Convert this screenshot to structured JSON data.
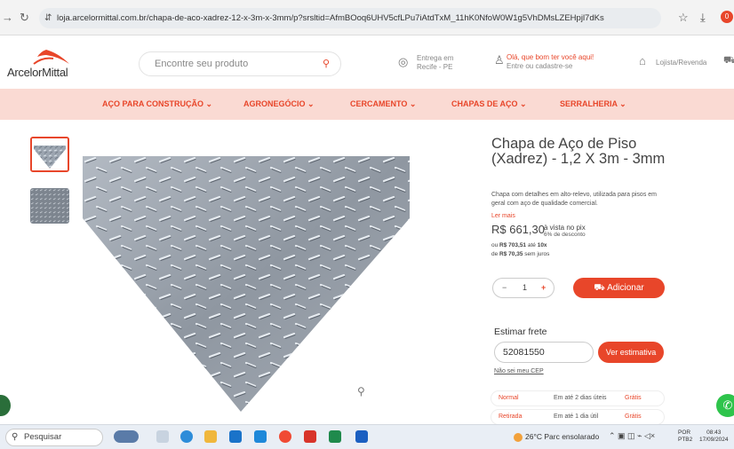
{
  "browser": {
    "url": "loja.arcelormittal.com.br/chapa-de-aco-xadrez-12-x-3m-x-3mm/p?srsltid=AfmBOoq6UHV5cfLPu7iAtdTxM_11hK0NfoW0W1g5VhDMsLZEHpjl7dKs",
    "extension_badge": "0"
  },
  "header": {
    "logo_text": "ArcelorMittal",
    "search_placeholder": "Encontre seu produto",
    "delivery_line1": "Entrega em",
    "delivery_line2": "Recife - PE",
    "greeting_line1": "Olá, que bom ter você aqui!",
    "greeting_line2": "Entre ou cadastre-se",
    "store_label": "Lojista/Revenda"
  },
  "categories": [
    {
      "label": "AÇO PARA CONSTRUÇÃO ⌄"
    },
    {
      "label": "AGRONEGÓCIO ⌄"
    },
    {
      "label": "CERCAMENTO ⌄"
    },
    {
      "label": "CHAPAS DE AÇO ⌄"
    },
    {
      "label": "SERRALHERIA ⌄"
    }
  ],
  "product": {
    "title": "Chapa de Aço de Piso (Xadrez) - 1,2 X 3m - 3mm",
    "description": "Chapa com detalhes em alto-relevo, utilizada para pisos em geral com aço de qualidade comercial.",
    "read_more": "Ler mais",
    "price": "R$ 661,30",
    "price_note": "à vista no pix",
    "discount": "6% de desconto",
    "install_prefix": "ou ",
    "install_total": "R$ 703,51",
    "install_mid": " até ",
    "install_count": "10x",
    "install_line2_prefix": "de ",
    "install_each": "R$ 70,35",
    "install_suffix": " sem juros",
    "quantity": "1",
    "add_button": "Adicionar"
  },
  "shipping": {
    "label": "Estimar frete",
    "cep_value": "52081550",
    "estimate_button": "Ver estimativa",
    "no_cep": "Não sei meu CEP",
    "options": [
      {
        "type": "Normal",
        "time": "Em até 2 dias úteis",
        "price": "Grátis"
      },
      {
        "type": "Retirada",
        "time": "Em até 1 dia útil",
        "price": "Grátis"
      }
    ]
  },
  "taskbar": {
    "search_label": "Pesquisar",
    "weather": "26°C  Parc ensolarado",
    "lang1": "POR",
    "lang2": "PTB2",
    "time": "08:43",
    "date": "17/09/2024"
  },
  "colors": {
    "accent": "#e8462a",
    "nav_bg": "#fadad3",
    "whatsapp": "#2ec44b"
  }
}
